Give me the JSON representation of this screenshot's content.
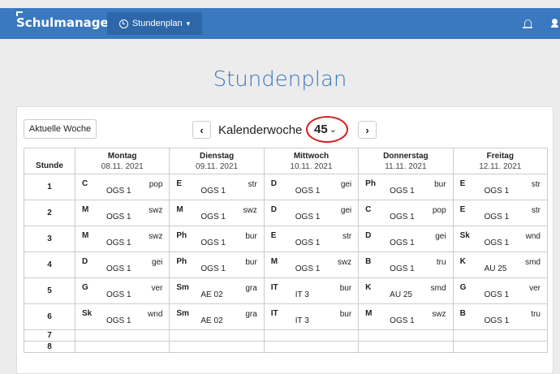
{
  "header": {
    "brand": "Schulmanager",
    "nav_label": "Stundenplan",
    "nav_caret": "▾"
  },
  "page": {
    "title": "Stundenplan"
  },
  "toolbar": {
    "current_week_label": "Aktuelle Woche",
    "prev": "‹",
    "next": "›",
    "kw_label": "Kalenderwoche",
    "kw_value": "45",
    "kw_chevron": "⌄"
  },
  "colors": {
    "brand": "#3a78bf",
    "highlight": "#d32020"
  },
  "table": {
    "hour_header": "Stunde",
    "days": [
      {
        "name": "Montag",
        "date": "08.11. 2021"
      },
      {
        "name": "Dienstag",
        "date": "09.11. 2021"
      },
      {
        "name": "Mittwoch",
        "date": "10.11. 2021"
      },
      {
        "name": "Donnerstag",
        "date": "11.11. 2021"
      },
      {
        "name": "Freitag",
        "date": "12.11. 2021"
      }
    ],
    "rows": [
      {
        "hour": "1",
        "cells": [
          {
            "subject": "C",
            "room": "OGS 1",
            "teacher": "pop"
          },
          {
            "subject": "E",
            "room": "OGS 1",
            "teacher": "str"
          },
          {
            "subject": "D",
            "room": "OGS 1",
            "teacher": "gei"
          },
          {
            "subject": "Ph",
            "room": "OGS 1",
            "teacher": "bur"
          },
          {
            "subject": "E",
            "room": "OGS 1",
            "teacher": "str"
          }
        ]
      },
      {
        "hour": "2",
        "cells": [
          {
            "subject": "M",
            "room": "OGS 1",
            "teacher": "swz"
          },
          {
            "subject": "M",
            "room": "OGS 1",
            "teacher": "swz"
          },
          {
            "subject": "D",
            "room": "OGS 1",
            "teacher": "gei"
          },
          {
            "subject": "C",
            "room": "OGS 1",
            "teacher": "pop"
          },
          {
            "subject": "E",
            "room": "OGS 1",
            "teacher": "str"
          }
        ]
      },
      {
        "hour": "3",
        "cells": [
          {
            "subject": "M",
            "room": "OGS 1",
            "teacher": "swz"
          },
          {
            "subject": "Ph",
            "room": "OGS 1",
            "teacher": "bur"
          },
          {
            "subject": "E",
            "room": "OGS 1",
            "teacher": "str"
          },
          {
            "subject": "D",
            "room": "OGS 1",
            "teacher": "gei"
          },
          {
            "subject": "Sk",
            "room": "OGS 1",
            "teacher": "wnd"
          }
        ]
      },
      {
        "hour": "4",
        "cells": [
          {
            "subject": "D",
            "room": "OGS 1",
            "teacher": "gei"
          },
          {
            "subject": "Ph",
            "room": "OGS 1",
            "teacher": "bur"
          },
          {
            "subject": "M",
            "room": "OGS 1",
            "teacher": "swz"
          },
          {
            "subject": "B",
            "room": "OGS 1",
            "teacher": "tru"
          },
          {
            "subject": "K",
            "room": "AU 25",
            "teacher": "smd"
          }
        ]
      },
      {
        "hour": "5",
        "cells": [
          {
            "subject": "G",
            "room": "OGS 1",
            "teacher": "ver"
          },
          {
            "subject": "Sm",
            "room": "AE 02",
            "teacher": "gra"
          },
          {
            "subject": "IT",
            "room": "IT 3",
            "teacher": "bur"
          },
          {
            "subject": "K",
            "room": "AU 25",
            "teacher": "smd"
          },
          {
            "subject": "G",
            "room": "OGS 1",
            "teacher": "ver"
          }
        ]
      },
      {
        "hour": "6",
        "cells": [
          {
            "subject": "Sk",
            "room": "OGS 1",
            "teacher": "wnd"
          },
          {
            "subject": "Sm",
            "room": "AE 02",
            "teacher": "gra"
          },
          {
            "subject": "IT",
            "room": "IT 3",
            "teacher": "bur"
          },
          {
            "subject": "M",
            "room": "OGS 1",
            "teacher": "swz"
          },
          {
            "subject": "B",
            "room": "OGS 1",
            "teacher": "tru"
          }
        ]
      }
    ],
    "empty_hours": [
      "7",
      "8"
    ]
  }
}
